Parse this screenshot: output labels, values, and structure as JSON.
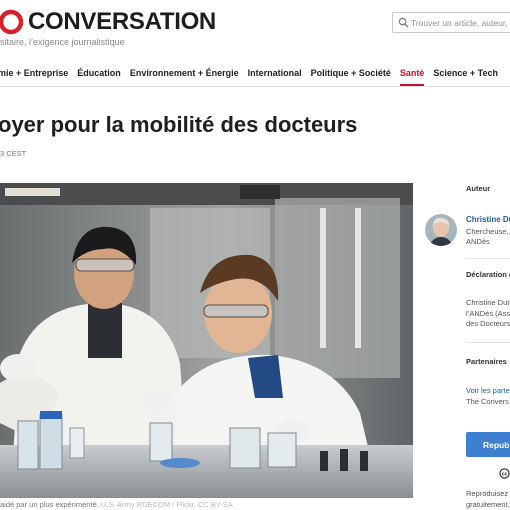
{
  "header": {
    "logo_text": "CONVERSATION",
    "tagline": "sitaire, l’exigence journalistique",
    "search_placeholder": "Trouver un article, auteur, éta"
  },
  "nav": {
    "items": [
      {
        "label": "mie + Entreprise",
        "active": false
      },
      {
        "label": "Éducation",
        "active": false
      },
      {
        "label": "Environnement + Énergie",
        "active": false
      },
      {
        "label": "International",
        "active": false
      },
      {
        "label": "Politique + Société",
        "active": false
      },
      {
        "label": "Santé",
        "active": true
      },
      {
        "label": "Science + Tech",
        "active": false
      }
    ]
  },
  "article": {
    "title": "oyer pour la mobilité des docteurs",
    "date": "3 CEST",
    "caption": "aidé par un plus expérimenté.",
    "caption_credit": "U.S. Army RDECOM / Flickr, CC BY-SA"
  },
  "sidebar": {
    "author_heading": "Auteur",
    "author_name": "Christine Du",
    "author_role_line1": "Chercheuse, ",
    "author_role_line2": "ANDès",
    "disclosure_heading": "Déclaration d",
    "disclosure_line1": "Christine Duth",
    "disclosure_line2": "l’ANDès (Ass",
    "disclosure_line3": "des Docteurs)",
    "partners_heading": "Partenaires",
    "partners_link": "Voir les parte",
    "partners_text": "The Convers",
    "republish_label": "Republ",
    "reproduce_line1": "Reproduisez n",
    "reproduce_line2": "gratuitement,"
  },
  "colors": {
    "brand_red": "#c8102e",
    "link_blue": "#1d5e9a",
    "button_blue": "#3d7fd0"
  }
}
